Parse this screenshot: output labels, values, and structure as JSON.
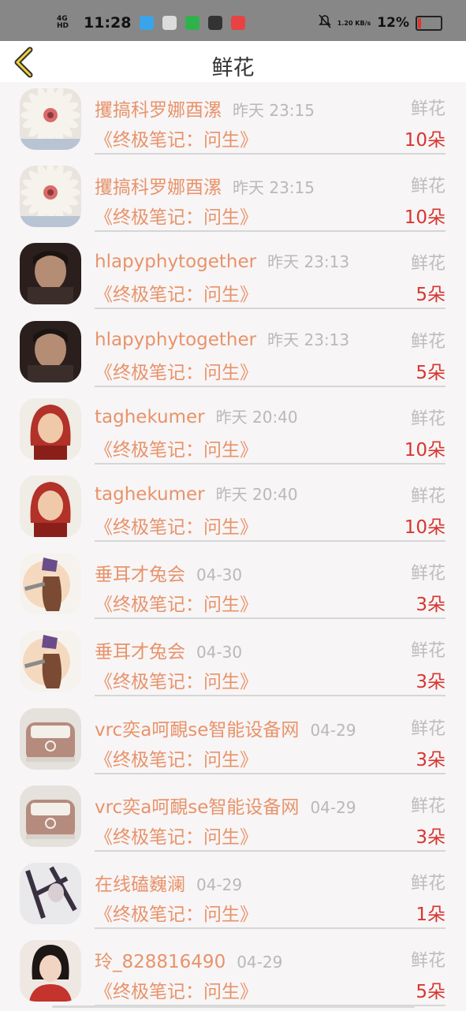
{
  "status": {
    "network": "4G HD",
    "time": "11:28",
    "speed": "1.20 KB/s",
    "battery": "12%"
  },
  "header": {
    "title": "鲜花",
    "back_icon": "chevron-left-icon"
  },
  "colors": {
    "accent": "#e8936a",
    "count": "#d8352f",
    "muted": "#bdbdbd"
  },
  "items": [
    {
      "name": "攫搞科罗娜酉漯",
      "time": "昨天 23:15",
      "type": "鲜花",
      "book": "《终极笔记：问生》",
      "count": "10朵",
      "avatar": "daisy"
    },
    {
      "name": "攫搞科罗娜酉漯",
      "time": "昨天 23:15",
      "type": "鲜花",
      "book": "《终极笔记：问生》",
      "count": "10朵",
      "avatar": "daisy"
    },
    {
      "name": "hlapyphytogether",
      "time": "昨天 23:13",
      "type": "鲜花",
      "book": "《终极笔记：问生》",
      "count": "5朵",
      "avatar": "man"
    },
    {
      "name": "hlapyphytogether",
      "time": "昨天 23:13",
      "type": "鲜花",
      "book": "《终极笔记：问生》",
      "count": "5朵",
      "avatar": "man"
    },
    {
      "name": "taghekumer",
      "time": "昨天 20:40",
      "type": "鲜花",
      "book": "《终极笔记：问生》",
      "count": "10朵",
      "avatar": "child"
    },
    {
      "name": "taghekumer",
      "time": "昨天 20:40",
      "type": "鲜花",
      "book": "《终极笔记：问生》",
      "count": "10朵",
      "avatar": "child"
    },
    {
      "name": "垂耳才兔会",
      "time": "04-30",
      "type": "鲜花",
      "book": "《终极笔记：问生》",
      "count": "3朵",
      "avatar": "cartoon"
    },
    {
      "name": "垂耳才兔会",
      "time": "04-30",
      "type": "鲜花",
      "book": "《终极笔记：问生》",
      "count": "3朵",
      "avatar": "cartoon"
    },
    {
      "name": "vrc奕a呵靦se智能设备网",
      "time": "04-29",
      "type": "鲜花",
      "book": "《终极笔记：问生》",
      "count": "3朵",
      "avatar": "van"
    },
    {
      "name": "vrc奕a呵靦se智能设备网",
      "time": "04-29",
      "type": "鲜花",
      "book": "《终极笔记：问生》",
      "count": "3朵",
      "avatar": "van"
    },
    {
      "name": "在线磕巍澜",
      "time": "04-29",
      "type": "鲜花",
      "book": "《终极笔记：问生》",
      "count": "1朵",
      "avatar": "art"
    },
    {
      "name": "玲_828816490",
      "time": "04-29",
      "type": "鲜花",
      "book": "《终极笔记：问生》",
      "count": "5朵",
      "avatar": "girl"
    }
  ]
}
